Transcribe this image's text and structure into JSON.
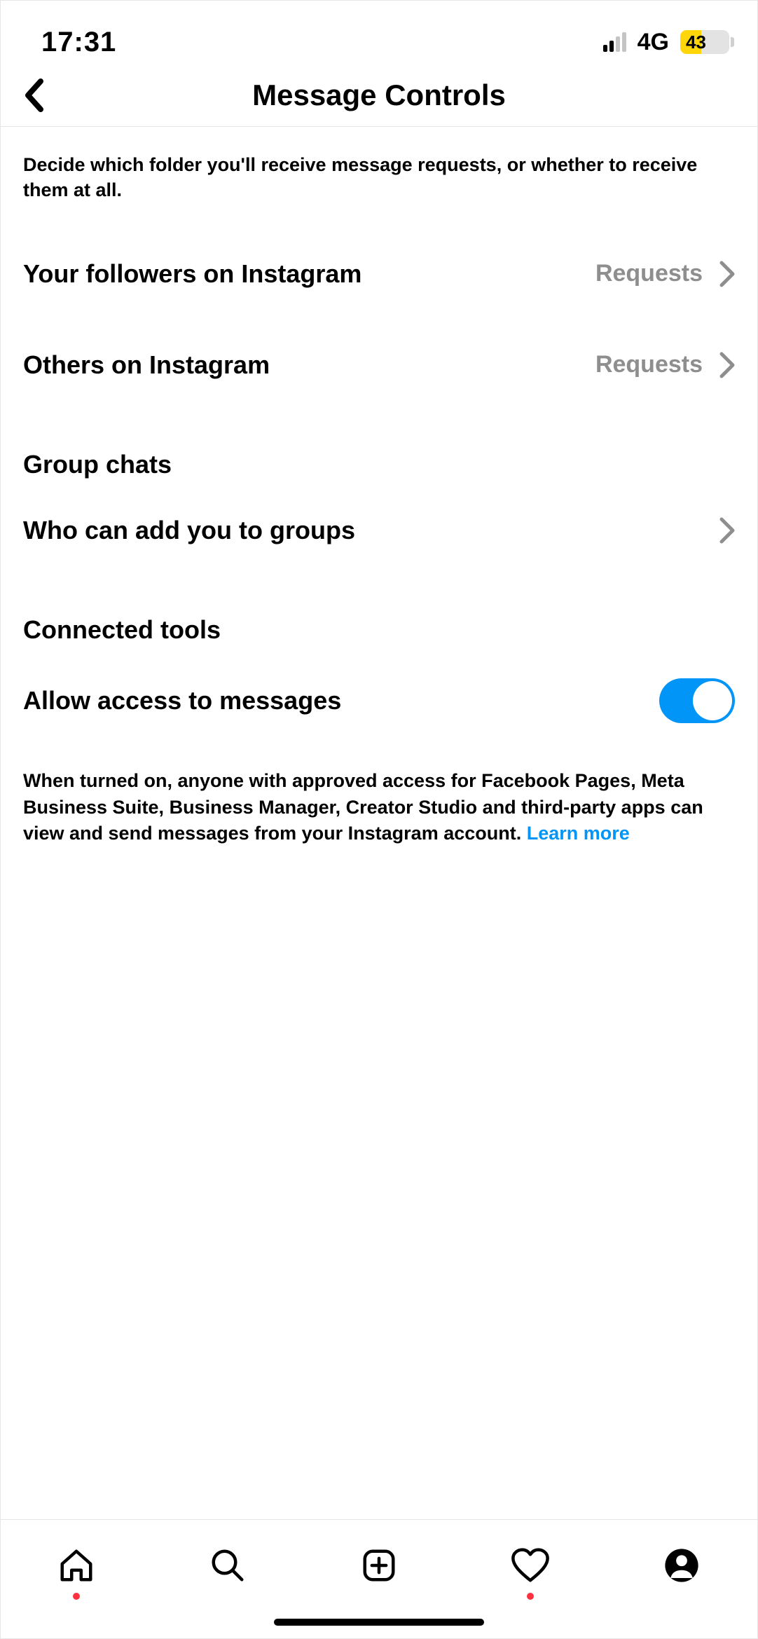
{
  "status_bar": {
    "time": "17:31",
    "network_type": "4G",
    "battery_percent": "43"
  },
  "header": {
    "title": "Message Controls"
  },
  "intro_text": "Decide which folder you'll receive message requests, or whether to receive them at all.",
  "settings": {
    "followers": {
      "label": "Your followers on Instagram",
      "value": "Requests"
    },
    "others": {
      "label": "Others on Instagram",
      "value": "Requests"
    }
  },
  "group_chats": {
    "section_title": "Group chats",
    "who_can_add": {
      "label": "Who can add you to groups"
    }
  },
  "connected_tools": {
    "section_title": "Connected tools",
    "allow_access": {
      "label": "Allow access to messages",
      "enabled": true
    },
    "footnote": "When turned on, anyone with approved access for Facebook Pages, Meta Business Suite, Business Manager, Creator Studio and third-party apps can view and send messages from your Instagram account. ",
    "learn_more": "Learn more"
  }
}
